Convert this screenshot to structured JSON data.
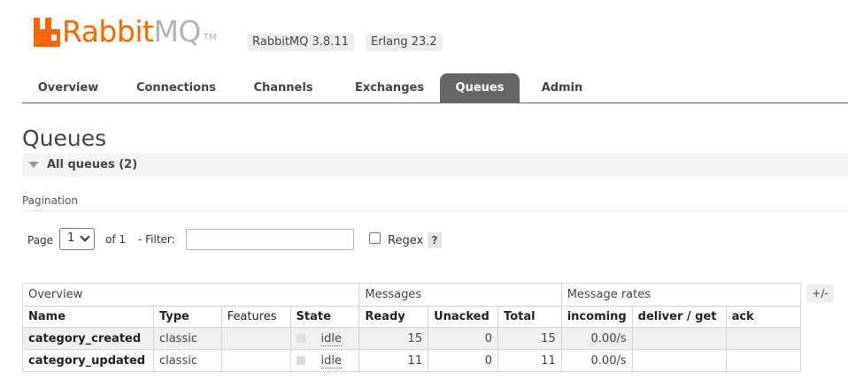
{
  "header": {
    "logo": {
      "part1": "Rabbit",
      "part2": "MQ",
      "tm": "TM"
    },
    "rabbitmq_version": "RabbitMQ 3.8.11",
    "erlang_version": "Erlang 23.2"
  },
  "nav": {
    "items": [
      {
        "label": "Overview"
      },
      {
        "label": "Connections"
      },
      {
        "label": "Channels"
      },
      {
        "label": "Exchanges"
      },
      {
        "label": "Queues",
        "active": true
      },
      {
        "label": "Admin"
      }
    ]
  },
  "page": {
    "title": "Queues",
    "section_label": "All queues (2)"
  },
  "pagination": {
    "label": "Pagination",
    "page_label": "Page",
    "page_value": "1",
    "of_label": "of 1",
    "filter_label": "- Filter:",
    "filter_value": "",
    "regex_label": "Regex",
    "regex_checked": false,
    "help_label": "?"
  },
  "table": {
    "toggle_label": "+/-",
    "groups": [
      "Overview",
      "Messages",
      "Message rates"
    ],
    "columns": [
      "Name",
      "Type",
      "Features",
      "State",
      "Ready",
      "Unacked",
      "Total",
      "incoming",
      "deliver / get",
      "ack"
    ],
    "rows": [
      {
        "name": "category_created",
        "type": "classic",
        "features": "",
        "state": "idle",
        "ready": "15",
        "unacked": "0",
        "total": "15",
        "incoming": "0.00/s",
        "deliver_get": "",
        "ack": ""
      },
      {
        "name": "category_updated",
        "type": "classic",
        "features": "",
        "state": "idle",
        "ready": "11",
        "unacked": "0",
        "total": "11",
        "incoming": "0.00/s",
        "deliver_get": "",
        "ack": ""
      }
    ]
  },
  "colors": {
    "brand": "#ff6600",
    "nav_active": "#666666"
  }
}
